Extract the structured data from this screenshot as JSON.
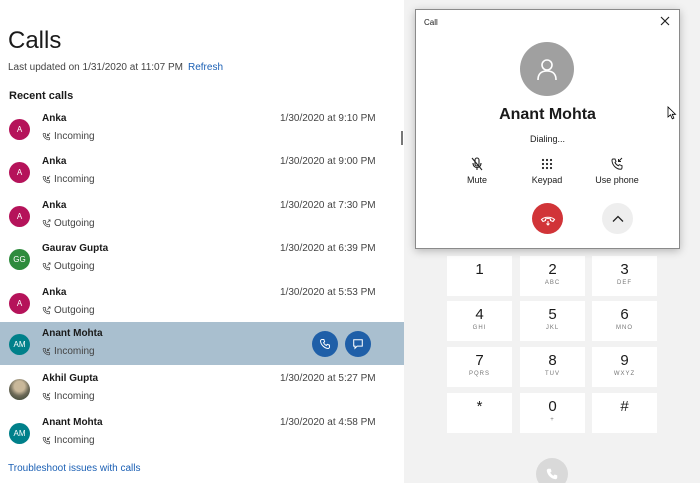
{
  "calls_page": {
    "title": "Calls",
    "last_updated": "Last updated on 1/31/2020 at 11:07 PM",
    "refresh_label": "Refresh",
    "recent_heading": "Recent calls",
    "troubleshoot_label": "Troubleshoot issues with calls"
  },
  "recent_calls": [
    {
      "initials": "A",
      "name": "Anka",
      "type": "Incoming",
      "datetime": "1/30/2020 at 9:10 PM",
      "avatar_color": "#b5135a"
    },
    {
      "initials": "A",
      "name": "Anka",
      "type": "Incoming",
      "datetime": "1/30/2020 at 9:00 PM",
      "avatar_color": "#b5135a"
    },
    {
      "initials": "A",
      "name": "Anka",
      "type": "Outgoing",
      "datetime": "1/30/2020 at 7:30 PM",
      "avatar_color": "#b5135a"
    },
    {
      "initials": "GG",
      "name": "Gaurav Gupta",
      "type": "Outgoing",
      "datetime": "1/30/2020 at 6:39 PM",
      "avatar_color": "#2e8b3d"
    },
    {
      "initials": "A",
      "name": "Anka",
      "type": "Outgoing",
      "datetime": "1/30/2020 at 5:53 PM",
      "avatar_color": "#b5135a"
    },
    {
      "initials": "AM",
      "name": "Anant Mohta",
      "type": "Incoming",
      "datetime": "",
      "avatar_color": "#00808a",
      "selected": true
    },
    {
      "initials": "",
      "name": "Akhil Gupta",
      "type": "Incoming",
      "datetime": "1/30/2020 at 5:27 PM",
      "avatar_color": "photo"
    },
    {
      "initials": "AM",
      "name": "Anant Mohta",
      "type": "Incoming",
      "datetime": "1/30/2020 at 4:58 PM",
      "avatar_color": "#00808a"
    }
  ],
  "call_window": {
    "title": "Call",
    "contact_name": "Anant Mohta",
    "status": "Dialing...",
    "controls": {
      "mute": "Mute",
      "keypad": "Keypad",
      "use_phone": "Use phone"
    }
  },
  "dialpad": [
    {
      "digit": "1",
      "letters": ""
    },
    {
      "digit": "2",
      "letters": "ABC"
    },
    {
      "digit": "3",
      "letters": "DEF"
    },
    {
      "digit": "4",
      "letters": "GHI"
    },
    {
      "digit": "5",
      "letters": "JKL"
    },
    {
      "digit": "6",
      "letters": "MNO"
    },
    {
      "digit": "7",
      "letters": "PQRS"
    },
    {
      "digit": "8",
      "letters": "TUV"
    },
    {
      "digit": "9",
      "letters": "WXYZ"
    },
    {
      "digit": "*",
      "letters": ""
    },
    {
      "digit": "0",
      "letters": "+"
    },
    {
      "digit": "#",
      "letters": ""
    }
  ],
  "colors": {
    "accent": "#1f5fa8",
    "link": "#1a5fb4",
    "selected_row": "#a9bfcf",
    "hangup": "#d13438"
  },
  "icons": [
    "phone-incoming-icon",
    "phone-outgoing-icon",
    "call-icon",
    "message-icon",
    "close-icon",
    "person-icon",
    "mute-icon",
    "keypad-icon",
    "use-phone-icon",
    "hang-up-icon",
    "chevron-up-icon"
  ]
}
